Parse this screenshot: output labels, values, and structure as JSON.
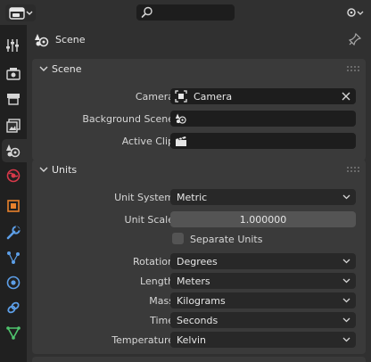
{
  "header": {
    "editor_type_icon": "properties-editor-icon",
    "search": {
      "value": "",
      "placeholder": ""
    }
  },
  "tabs": [
    {
      "name": "tool",
      "icon": "tool-icon"
    },
    {
      "name": "render",
      "icon": "render-icon"
    },
    {
      "name": "output",
      "icon": "output-icon"
    },
    {
      "name": "view-layer",
      "icon": "view-layer-icon"
    },
    {
      "name": "scene",
      "icon": "scene-icon",
      "active": true
    },
    {
      "name": "world",
      "icon": "world-icon"
    },
    {
      "name": "object",
      "icon": "object-icon"
    },
    {
      "name": "modifiers",
      "icon": "wrench-icon"
    },
    {
      "name": "particles",
      "icon": "particles-icon"
    },
    {
      "name": "physics",
      "icon": "physics-icon"
    },
    {
      "name": "object-constraints",
      "icon": "constraint-icon"
    },
    {
      "name": "object-data",
      "icon": "mesh-data-icon"
    }
  ],
  "context": {
    "title": "Scene"
  },
  "scene_panel": {
    "title": "Scene",
    "camera_label": "Camera",
    "camera_value": "Camera",
    "background_scene_label": "Background Scene",
    "background_scene_value": "",
    "active_clip_label": "Active Clip",
    "active_clip_value": ""
  },
  "units_panel": {
    "title": "Units",
    "unit_system_label": "Unit System",
    "unit_system_value": "Metric",
    "unit_scale_label": "Unit Scale",
    "unit_scale_value": "1.000000",
    "separate_units_label": "Separate Units",
    "separate_units_checked": false,
    "rotation_label": "Rotation",
    "rotation_value": "Degrees",
    "length_label": "Length",
    "length_value": "Meters",
    "mass_label": "Mass",
    "mass_value": "Kilograms",
    "time_label": "Time",
    "time_value": "Seconds",
    "temperature_label": "Temperature",
    "temperature_value": "Kelvin"
  },
  "colors": {
    "background": "#303030",
    "panel": "#3a3a3a",
    "field": "#1d1d1d",
    "numeric_field": "#545454",
    "tabbar": "#202020",
    "object_tab_orange": "#e8812c",
    "world_tab_red": "#d8394a",
    "modifier_tab_blue": "#5d9fe8",
    "data_tab_green": "#4fc46d"
  }
}
